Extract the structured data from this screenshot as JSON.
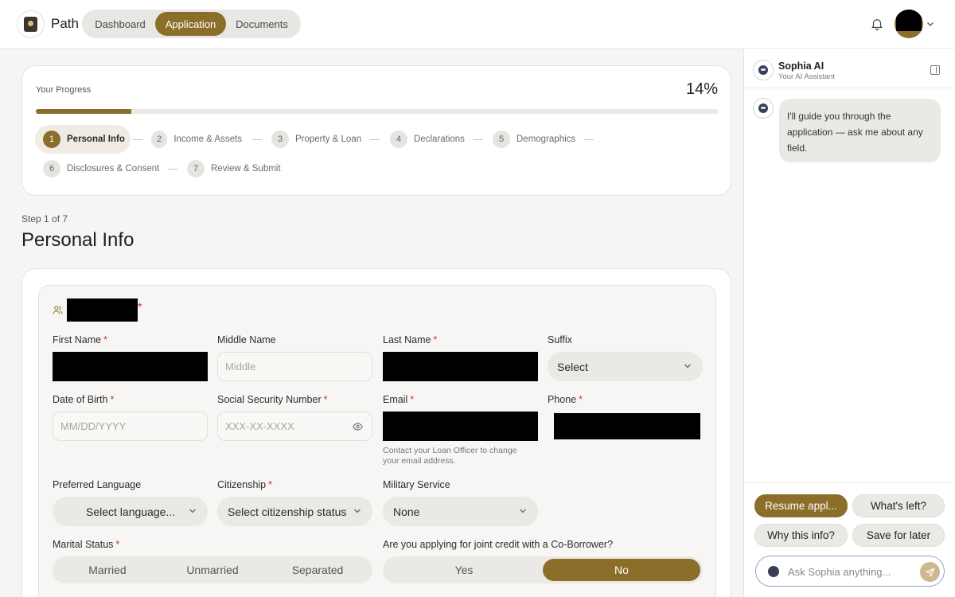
{
  "app": {
    "name": "Path"
  },
  "nav": {
    "tabs": [
      {
        "label": "Dashboard"
      },
      {
        "label": "Application"
      },
      {
        "label": "Documents"
      }
    ],
    "active": "Application"
  },
  "progress": {
    "label": "Your Progress",
    "percent_text": "14%",
    "percent": 14
  },
  "steps": [
    {
      "num": "1",
      "label": "Personal Info",
      "active": true
    },
    {
      "num": "2",
      "label": "Income & Assets"
    },
    {
      "num": "3",
      "label": "Property & Loan"
    },
    {
      "num": "4",
      "label": "Declarations"
    },
    {
      "num": "5",
      "label": "Demographics"
    },
    {
      "num": "6",
      "label": "Disclosures & Consent"
    },
    {
      "num": "7",
      "label": "Review & Submit"
    }
  ],
  "page": {
    "step_of": "Step 1 of 7",
    "title": "Personal Info"
  },
  "form": {
    "section_required_mark": "*",
    "required_mark": "*",
    "first_name": {
      "label": "First Name"
    },
    "middle_name": {
      "label": "Middle Name",
      "placeholder": "Middle"
    },
    "last_name": {
      "label": "Last Name"
    },
    "suffix": {
      "label": "Suffix",
      "value": "Select"
    },
    "dob": {
      "label": "Date of Birth",
      "placeholder": "MM/DD/YYYY"
    },
    "ssn": {
      "label": "Social Security Number",
      "placeholder": "XXX-XX-XXXX"
    },
    "email": {
      "label": "Email",
      "hint": "Contact your Loan Officer to change your email address."
    },
    "phone": {
      "label": "Phone"
    },
    "language": {
      "label": "Preferred Language",
      "value": "Select language..."
    },
    "citizenship": {
      "label": "Citizenship",
      "value": "Select citizenship status"
    },
    "military": {
      "label": "Military Service",
      "value": "None"
    },
    "marital": {
      "label": "Marital Status",
      "options": [
        "Married",
        "Unmarried",
        "Separated"
      ]
    },
    "joint": {
      "label": "Are you applying for joint credit with a Co-Borrower?",
      "options": [
        "Yes",
        "No"
      ],
      "selected": "No"
    }
  },
  "assistant": {
    "name": "Sophia AI",
    "subtitle": "Your AI Assistant",
    "message": "I'll guide you through the application — ask me about any field.",
    "chips": [
      "Resume appl...",
      "What's left?",
      "Why this info?",
      "Save for later"
    ],
    "input_placeholder": "Ask Sophia anything..."
  },
  "colors": {
    "accent": "#8b6e2a",
    "required": "#c23b2b"
  }
}
